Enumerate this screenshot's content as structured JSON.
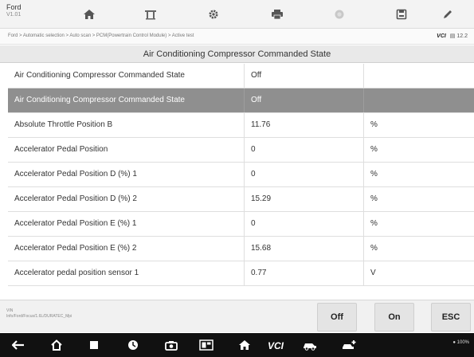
{
  "app": {
    "name": "Ford",
    "version": "V1.01"
  },
  "toolbar": {
    "items": [
      {
        "icon": "home-icon"
      },
      {
        "icon": "vehicle-lift-icon"
      },
      {
        "icon": "settings-gear-icon"
      },
      {
        "icon": "print-icon"
      },
      {
        "icon": "record-icon"
      },
      {
        "icon": "save-icon"
      },
      {
        "icon": "edit-pen-icon"
      }
    ]
  },
  "breadcrumb": "Ford > Automatic selection > Auto scan > PCM(Powertrain Control Module) > Active test",
  "vci": {
    "label": "VCI",
    "text": "12.2"
  },
  "title": "Air Conditioning Compressor Commanded State",
  "rows": [
    {
      "name": "Air Conditioning Compressor Commanded State",
      "value": "Off",
      "unit": "",
      "selected": false
    },
    {
      "name": "Air Conditioning Compressor Commanded State",
      "value": "Off",
      "unit": "",
      "selected": true
    },
    {
      "name": "Absolute Throttle Position B",
      "value": "11.76",
      "unit": "%",
      "selected": false
    },
    {
      "name": "Accelerator Pedal Position",
      "value": "0",
      "unit": "%",
      "selected": false
    },
    {
      "name": "Accelerator Pedal Position D (%) 1",
      "value": "0",
      "unit": "%",
      "selected": false
    },
    {
      "name": "Accelerator Pedal Position D (%) 2",
      "value": "15.29",
      "unit": "%",
      "selected": false
    },
    {
      "name": "Accelerator Pedal Position E (%) 1",
      "value": "0",
      "unit": "%",
      "selected": false
    },
    {
      "name": "Accelerator Pedal Position E (%) 2",
      "value": "15.68",
      "unit": "%",
      "selected": false
    },
    {
      "name": "Accelerator pedal position sensor 1",
      "value": "0.77",
      "unit": "V",
      "selected": false
    }
  ],
  "footer": {
    "info_line1": "VIN",
    "info_line2": "Info/Ford/Focus/1.6L/DURATEC_Mpi"
  },
  "buttons": {
    "off": "Off",
    "on": "On",
    "esc": "ESC"
  },
  "navbar": {
    "items": [
      {
        "icon": "back-arrow-icon"
      },
      {
        "icon": "home-outline-icon"
      },
      {
        "icon": "recent-apps-icon"
      },
      {
        "icon": "browser-icon"
      },
      {
        "icon": "camera-icon"
      },
      {
        "icon": "screen-capture-icon"
      },
      {
        "icon": "maxisys-home-icon"
      },
      {
        "icon": "vci-icon"
      },
      {
        "icon": "vehicle-icon"
      },
      {
        "icon": "vehicle-plus-icon"
      }
    ],
    "status": "100%"
  }
}
